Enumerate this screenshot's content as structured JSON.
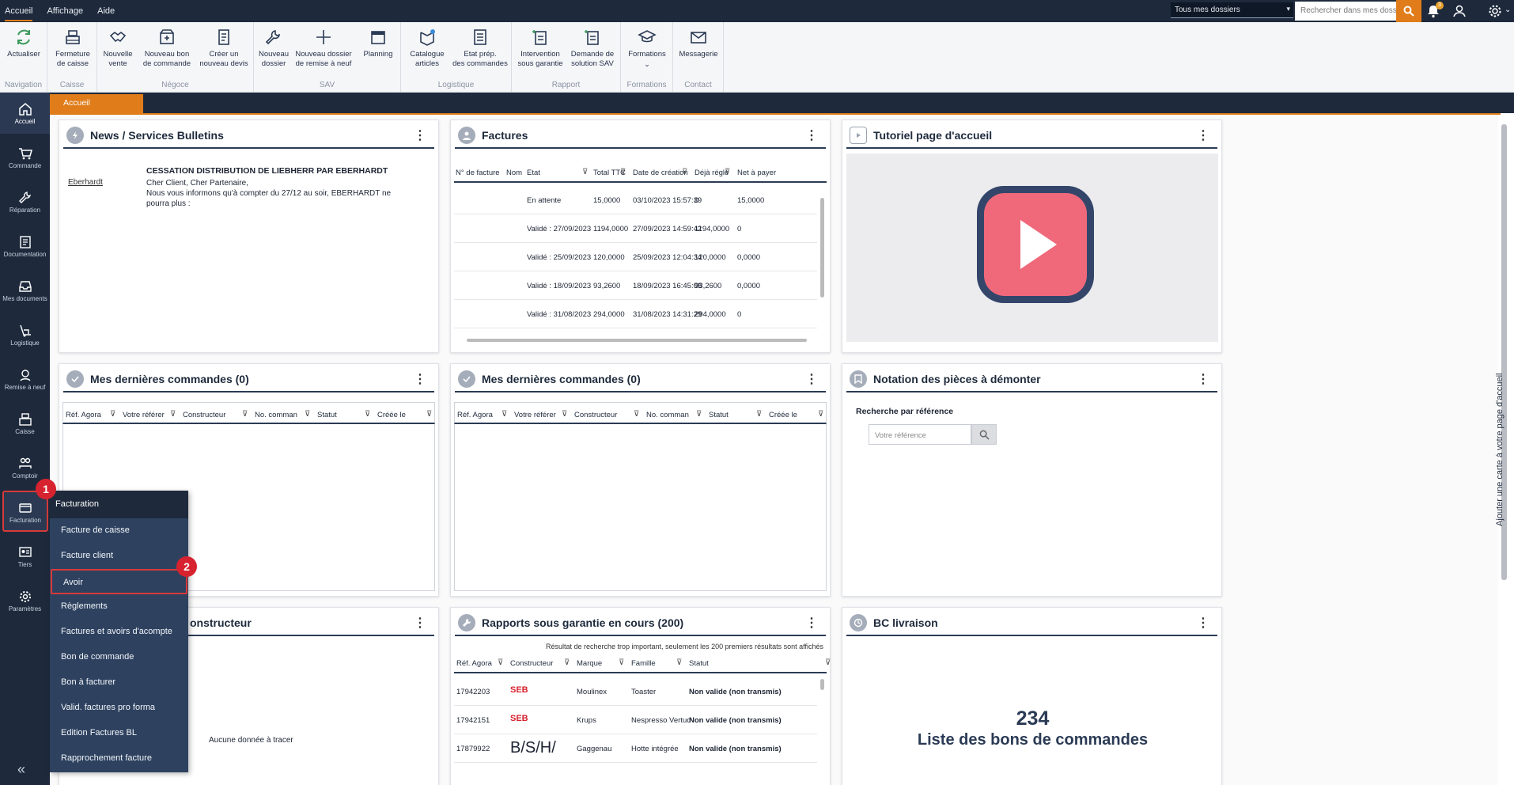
{
  "topbar": {
    "menu": [
      "Accueil",
      "Affichage",
      "Aide"
    ],
    "dossier": "Tous mes dossiers",
    "search_placeholder": "Rechercher dans mes dossiers",
    "notif_count": "3"
  },
  "ribbon": {
    "groups": [
      {
        "title": "Navigation",
        "buttons": [
          "Actualiser"
        ]
      },
      {
        "title": "Caisse",
        "buttons": [
          "Fermeture\nde caisse"
        ]
      },
      {
        "title": "Négoce",
        "buttons": [
          "Nouvelle\nvente",
          "Nouveau bon\nde commande",
          "Créer un\nnouveau devis"
        ]
      },
      {
        "title": "SAV",
        "buttons": [
          "Nouveau\ndossier",
          "Nouveau dossier\nde remise à neuf",
          "Planning"
        ]
      },
      {
        "title": "Logistique",
        "buttons": [
          "Catalogue\narticles",
          "Etat prép.\ndes commandes"
        ]
      },
      {
        "title": "Rapport",
        "buttons": [
          "Intervention\nsous garantie",
          "Demande de\nsolution SAV"
        ]
      },
      {
        "title": "Formations",
        "buttons": [
          "Formations"
        ]
      },
      {
        "title": "Contact",
        "buttons": [
          "Messagerie"
        ]
      }
    ]
  },
  "tab": "Accueil",
  "leftnav": [
    "Accueil",
    "Commande",
    "Réparation",
    "Documentation",
    "Mes documents",
    "Logistique",
    "Remise à neuf",
    "Caisse",
    "Comptoir",
    "Facturation",
    "Tiers",
    "Paramètres"
  ],
  "news": {
    "title": "News / Services Bulletins",
    "logo": "Eberhardt",
    "headline": "CESSATION DISTRIBUTION DE LIEBHERR PAR EBERHARDT",
    "line1": "Cher Client, Cher Partenaire,",
    "line2": "Nous vous informons qu'à compter du 27/12 au soir, EBERHARDT ne",
    "line3": "pourra plus :"
  },
  "factures": {
    "title": "Factures",
    "columns": [
      "N° de facture",
      "Nom",
      "Etat",
      "Total TTC",
      "Date de création",
      "Déjà réglé",
      "Net à payer"
    ],
    "rows": [
      [
        "",
        "",
        "En attente",
        "15,0000",
        "03/10/2023 15:57:39",
        "0",
        "15,0000"
      ],
      [
        "",
        "",
        "Validé : 27/09/2023",
        "1194,0000",
        "27/09/2023 14:59:42",
        "1194,0000",
        "0"
      ],
      [
        "",
        "",
        "Validé : 25/09/2023",
        "120,0000",
        "25/09/2023 12:04:34",
        "120,0000",
        "0,0000"
      ],
      [
        "",
        "",
        "Validé : 18/09/2023",
        "93,2600",
        "18/09/2023 16:45:08",
        "93,2600",
        "0,0000"
      ],
      [
        "",
        "",
        "Validé : 31/08/2023",
        "294,0000",
        "31/08/2023 14:31:29",
        "294,0000",
        "0"
      ]
    ]
  },
  "tutoriel": {
    "title": "Tutoriel page d'accueil"
  },
  "cmd1": {
    "title": "Mes dernières commandes (0)",
    "columns": [
      "Réf. Agora",
      "Votre référer",
      "Constructeur",
      "No. comman",
      "Statut",
      "Créée le"
    ]
  },
  "cmd2": {
    "title": "Mes dernières commandes (0)",
    "columns": [
      "Réf. Agora",
      "Votre référer",
      "Constructeur",
      "No. comman",
      "Statut",
      "Créée le"
    ]
  },
  "notation": {
    "title": "Notation des pièces à démonter",
    "label": "Recherche par référence",
    "placeholder": "Votre référence"
  },
  "constructeur": {
    "title_fragment": "onstructeur",
    "empty": "Aucune donnée à tracer"
  },
  "rapports": {
    "title": "Rapports sous garantie en cours (200)",
    "notice": "Résultat de recherche trop important, seulement les 200 premiers résultats sont affichés",
    "columns": [
      "Réf. Agora",
      "Constructeur",
      "Marque",
      "Famille",
      "Statut"
    ],
    "rows": [
      [
        "17942203",
        "SEB",
        "Moulinex",
        "Toaster",
        "Non valide (non transmis)"
      ],
      [
        "17942151",
        "SEB",
        "Krups",
        "Nespresso Vertuo",
        "Non valide (non transmis)"
      ],
      [
        "17879922",
        "B/S/H/",
        "Gaggenau",
        "Hotte intégrée",
        "Non valide (non transmis)"
      ]
    ]
  },
  "bc": {
    "title": "BC livraison",
    "count": "234",
    "label": "Liste des bons de commandes"
  },
  "sidelabel": "Ajouter une carte à votre page d'accueil",
  "dropdown": {
    "title": "Facturation",
    "items": [
      "Facture de caisse",
      "Facture client",
      "Avoir",
      "Règlements",
      "Factures et avoirs d'acompte",
      "Bon de commande",
      "Bon à facturer",
      "Valid. factures pro forma",
      "Edition Factures BL",
      "Rapprochement facture"
    ]
  },
  "markers": [
    "1",
    "2"
  ],
  "colors": {
    "accent": "#e07c19",
    "navy": "#1e2a3c",
    "marker": "#d7232f",
    "play": "#f0697a"
  }
}
